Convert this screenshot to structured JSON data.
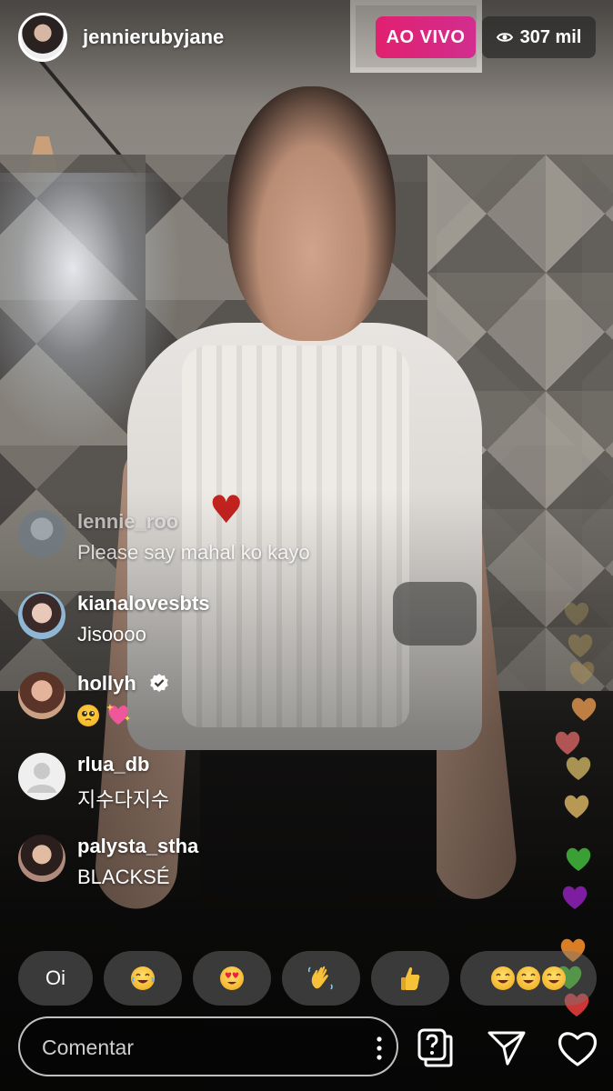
{
  "header": {
    "username": "jennierubyjane",
    "live_label": "AO VIVO",
    "viewer_count": "307 mil"
  },
  "comments": [
    {
      "user": "lennie_roo",
      "text": "Please say mahal ko kayo"
    },
    {
      "user": "kianalovesbts",
      "text": "Jisoooo"
    },
    {
      "user": "hollyh",
      "text": "",
      "verified": true,
      "emojis": [
        "pleading-face",
        "sparkling-heart"
      ]
    },
    {
      "user": "rlua_db",
      "text": "지수다지수"
    },
    {
      "user": "palysta_stha",
      "text": "BLACKSÉ"
    }
  ],
  "quick_reactions": [
    {
      "label": "Oi"
    },
    {
      "emoji": "tears-of-joy"
    },
    {
      "emoji": "heart-eyes"
    },
    {
      "emoji": "waving-hand"
    },
    {
      "emoji": "thumbs-up"
    },
    {
      "emoji": "tears-of-joy-x3"
    }
  ],
  "floating_hearts_colors": [
    "#b8a15a",
    "#c9a75c",
    "#c9a34f",
    "#d08a4a",
    "#c25b5b",
    "#b8a15a",
    "#c9a75c",
    "#3fb03a",
    "#8a1fb0",
    "#f08a2a",
    "#3fbf2a",
    "#e23b3b"
  ],
  "composer": {
    "placeholder": "Comentar"
  },
  "colors": {
    "live_badge": "#e1206f",
    "text": "#ffffff"
  }
}
